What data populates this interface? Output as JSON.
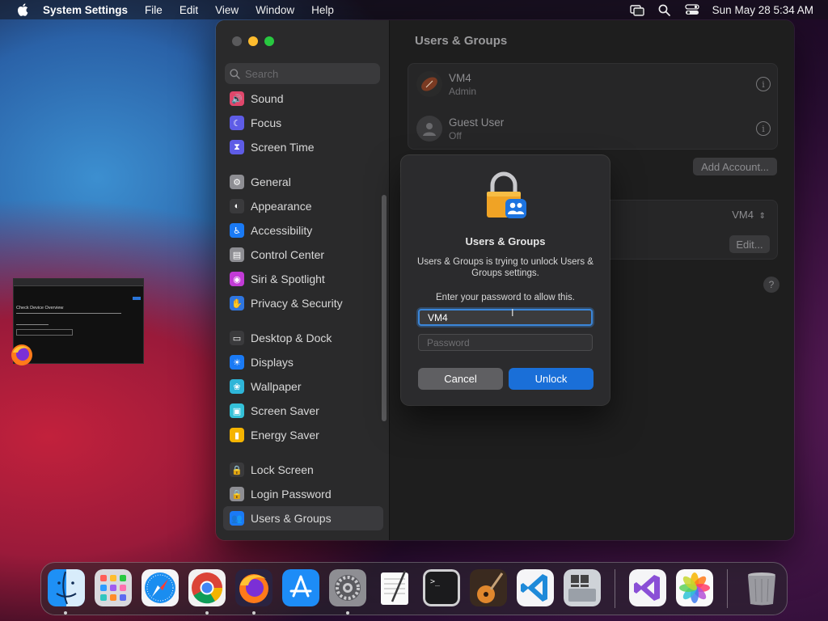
{
  "menubar": {
    "app_name": "System Settings",
    "items": [
      "File",
      "Edit",
      "View",
      "Window",
      "Help"
    ],
    "clock": "Sun May 28  5:34 AM"
  },
  "sidebar": {
    "search_placeholder": "Search",
    "groups": [
      [
        {
          "label": "Sound",
          "icon": "speaker-icon",
          "color": "#e0476b"
        },
        {
          "label": "Focus",
          "icon": "moon-icon",
          "color": "#5e5ce6"
        },
        {
          "label": "Screen Time",
          "icon": "hourglass-icon",
          "color": "#5e5ce6"
        }
      ],
      [
        {
          "label": "General",
          "icon": "gear-icon",
          "color": "#8e8e93"
        },
        {
          "label": "Appearance",
          "icon": "appearance-icon",
          "color": "#3a3a3c"
        },
        {
          "label": "Accessibility",
          "icon": "accessibility-icon",
          "color": "#1a7af5"
        },
        {
          "label": "Control Center",
          "icon": "control-center-icon",
          "color": "#8e8e93"
        },
        {
          "label": "Siri & Spotlight",
          "icon": "siri-icon",
          "color": "#c23bd6"
        },
        {
          "label": "Privacy & Security",
          "icon": "hand-icon",
          "color": "#2f76e0"
        }
      ],
      [
        {
          "label": "Desktop & Dock",
          "icon": "dock-icon",
          "color": "#3a3a3c"
        },
        {
          "label": "Displays",
          "icon": "sun-icon",
          "color": "#1a7af5"
        },
        {
          "label": "Wallpaper",
          "icon": "wallpaper-icon",
          "color": "#2eb5d8"
        },
        {
          "label": "Screen Saver",
          "icon": "screen-saver-icon",
          "color": "#34c1d8"
        },
        {
          "label": "Energy Saver",
          "icon": "battery-icon",
          "color": "#f5b400"
        }
      ],
      [
        {
          "label": "Lock Screen",
          "icon": "lock-icon",
          "color": "#3a3a3c"
        },
        {
          "label": "Login Password",
          "icon": "lock-icon",
          "color": "#8e8e93"
        },
        {
          "label": "Users & Groups",
          "icon": "users-icon",
          "color": "#1a7af5",
          "selected": true
        }
      ]
    ]
  },
  "main": {
    "title": "Users & Groups",
    "users": [
      {
        "name": "VM4",
        "role": "Admin"
      },
      {
        "name": "Guest User",
        "role": "Off"
      }
    ],
    "add_account_label": "Add Account...",
    "auto_login_value": "VM4",
    "edit_label": "Edit...",
    "help_label": "?"
  },
  "dialog": {
    "title": "Users & Groups",
    "message": "Users & Groups is trying to unlock Users & Groups settings.",
    "prompt": "Enter your password to allow this.",
    "username_value": "VM4",
    "password_placeholder": "Password",
    "cancel_label": "Cancel",
    "unlock_label": "Unlock"
  },
  "thumbnail": {
    "heading": "Check Device Overview"
  },
  "dock": {
    "apps": [
      "Finder",
      "Launchpad",
      "Safari",
      "Google Chrome",
      "Firefox",
      "App Store",
      "System Settings",
      "TextEdit",
      "Terminal",
      "GarageBand",
      "Visual Studio Code",
      "Boot Camp Assistant",
      "Visual Studio",
      "Photos",
      "Trash"
    ]
  }
}
